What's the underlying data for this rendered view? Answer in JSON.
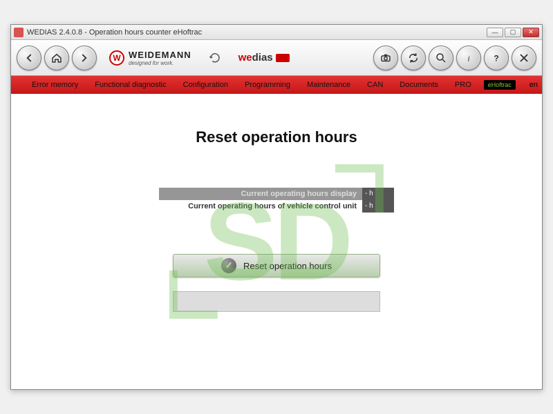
{
  "window": {
    "title": "WEDIAS 2.4.0.8 - Operation hours counter eHoftrac"
  },
  "brands": {
    "weidemann": {
      "name": "WEIDEMANN",
      "tagline": "designed for work."
    },
    "wedias": {
      "pre": "we",
      "post": "dias"
    }
  },
  "tabs": {
    "error": "Error memory",
    "diag": "Functional diagnostic",
    "config": "Configuration",
    "prog": "Programming",
    "maint": "Maintenance",
    "can": "CAN",
    "docs": "Documents",
    "pro": "PRO",
    "device": "eHoftrac",
    "lang": "en"
  },
  "page": {
    "title": "Reset operation hours",
    "row1_label": "Current operating hours display",
    "row1_value": "- h",
    "row2_label": "Current operating hours of vehicle control unit",
    "row2_value": "- h",
    "reset_label": "Reset operation hours"
  }
}
